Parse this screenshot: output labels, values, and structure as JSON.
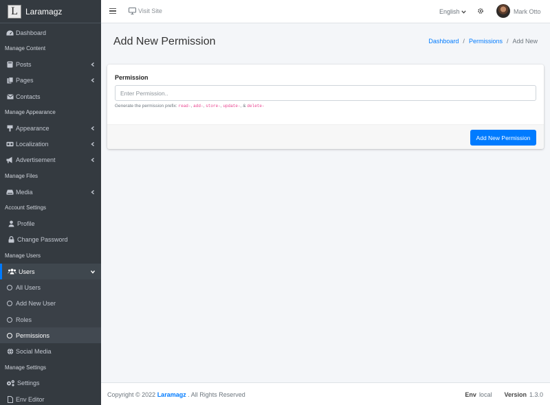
{
  "brand": {
    "logo_letter": "L",
    "name": "Laramagz"
  },
  "sidebar": {
    "dashboard": "Dashboard",
    "h_content": "Manage Content",
    "posts": "Posts",
    "pages": "Pages",
    "contacts": "Contacts",
    "h_appearance": "Manage Appearance",
    "appearance": "Appearance",
    "localization": "Localization",
    "advertisement": "Advertisement",
    "h_files": "Manage Files",
    "media": "Media",
    "h_account": "Account Settings",
    "profile": "Profile",
    "change_password": "Change Password",
    "h_users": "Manage Users",
    "users": "Users",
    "all_users": "All Users",
    "add_new_user": "Add New User",
    "roles": "Roles",
    "permissions": "Permissions",
    "social_media": "Social Media",
    "h_settings": "Manage Settings",
    "settings": "Settings",
    "env_editor": "Env Editor"
  },
  "topnav": {
    "visit_site": "Visit Site",
    "language": "English",
    "user_name": "Mark Otto"
  },
  "page": {
    "title": "Add New Permission",
    "breadcrumb": {
      "dashboard": "Dashboard",
      "permissions": "Permissions",
      "current": "Add New"
    }
  },
  "form": {
    "label": "Permission",
    "placeholder": "Enter Permission..",
    "help_prefix": "Generate the permission prefix: ",
    "codes": [
      "read-",
      "add-",
      "store-",
      "update-",
      "delete-"
    ],
    "submit": "Add New Permission"
  },
  "footer": {
    "copyright_prefix": "Copyright © 2022",
    "brand": "Laramagz",
    "copyright_suffix": ". All Rights Reserved",
    "env_label": "Env",
    "env_value": "local",
    "version_label": "Version",
    "version_value": "1.3.0"
  },
  "colors": {
    "accent": "#007bff",
    "sidebar_bg": "#343a40",
    "code": "#e83e8c"
  }
}
